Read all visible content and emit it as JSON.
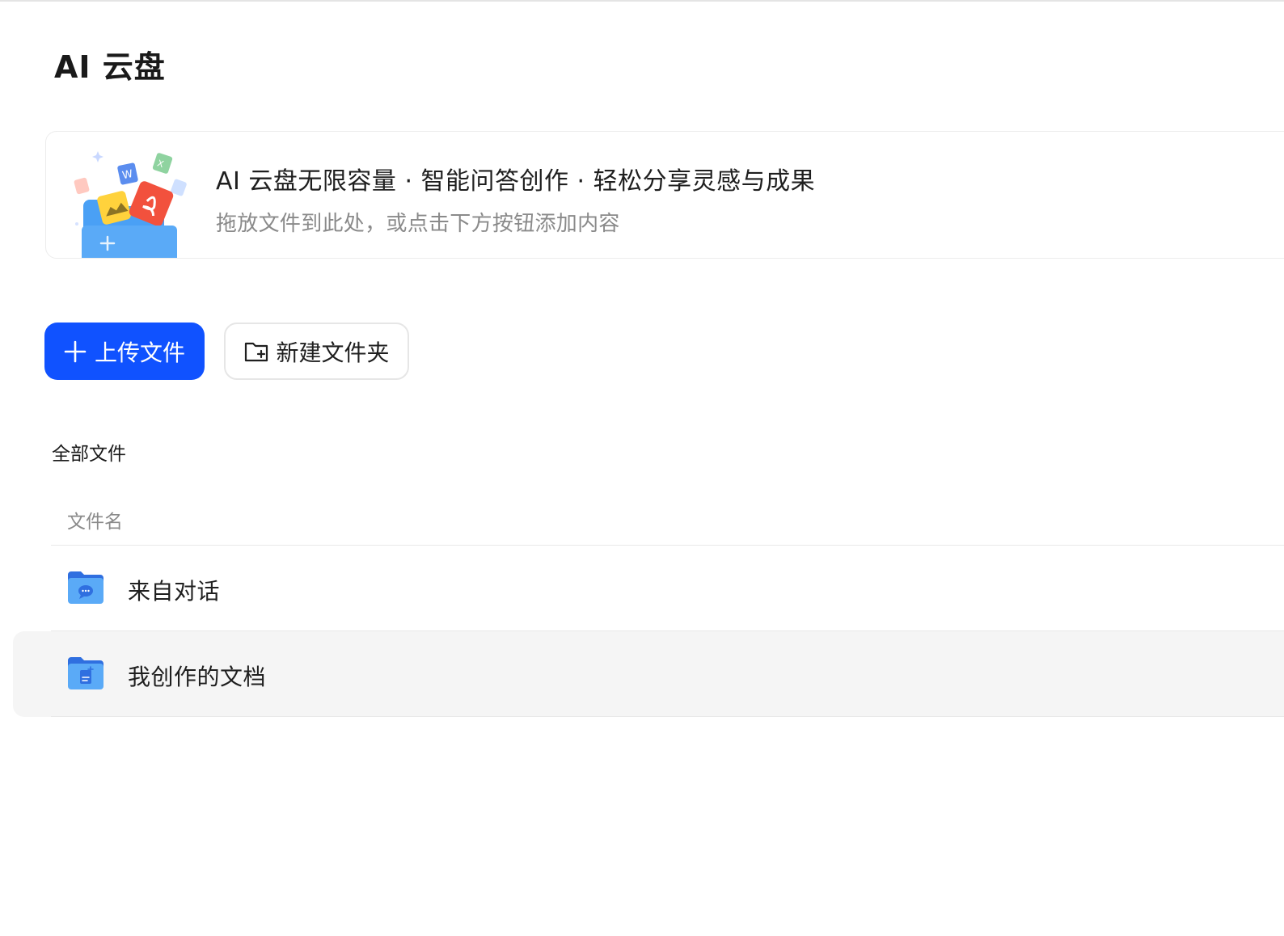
{
  "page": {
    "title": "AI 云盘"
  },
  "banner": {
    "title": "AI 云盘无限容量 · 智能问答创作 · 轻松分享灵感与成果",
    "subtitle": "拖放文件到此处，或点击下方按钮添加内容",
    "illustration_icon": "files-into-folder-illustration"
  },
  "actions": {
    "upload_label": "上传文件",
    "upload_icon": "plus-icon",
    "new_folder_label": "新建文件夹",
    "new_folder_icon": "folder-add-icon"
  },
  "files": {
    "section_label": "全部文件",
    "column_name": "文件名",
    "rows": [
      {
        "name": "来自对话",
        "icon": "chat-folder-icon",
        "hovered": false
      },
      {
        "name": "我创作的文档",
        "icon": "document-folder-icon",
        "hovered": true
      }
    ]
  },
  "colors": {
    "primary": "#1052ff",
    "folder_blue": "#3b8bf0",
    "row_hover": "#f5f5f5"
  }
}
